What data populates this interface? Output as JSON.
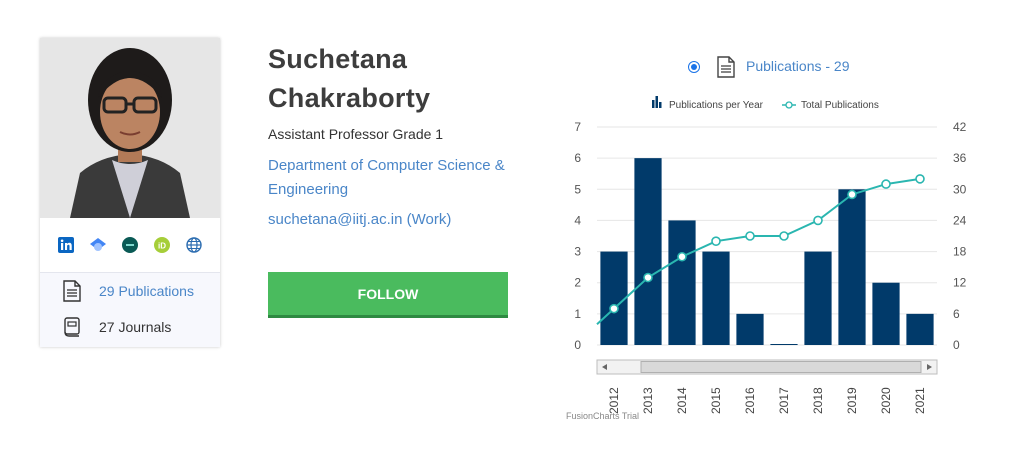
{
  "profile": {
    "name_line1": "Suchetana",
    "name_line2": "Chakraborty",
    "title": "Assistant Professor Grade 1",
    "department": "Department of Computer Science & Engineering",
    "email": "suchetana@iitj.ac.in (Work)",
    "follow_label": "FOLLOW",
    "social_icons": [
      "linkedin-icon",
      "google-scholar-icon",
      "researchgate-icon",
      "orcid-icon",
      "website-globe-icon"
    ],
    "stats": {
      "publications": "29 Publications",
      "journals": "27 Journals"
    }
  },
  "publications_header": {
    "label": "Publications - 29",
    "selected": true
  },
  "colors": {
    "bar": "#013a6a",
    "line": "#2ab6b0",
    "link": "#4a86c8",
    "follow": "#4abb5e"
  },
  "chart_data": {
    "type": "bar",
    "categories": [
      "2012",
      "2013",
      "2014",
      "2015",
      "2016",
      "2017",
      "2018",
      "2019",
      "2020",
      "2021"
    ],
    "series": [
      {
        "name": "Publications per Year",
        "type": "bar",
        "axis": "left",
        "values": [
          3,
          6,
          4,
          3,
          1,
          0,
          3,
          5,
          2,
          1
        ]
      },
      {
        "name": "Total Publications",
        "type": "line",
        "axis": "right",
        "values": [
          7,
          13,
          17,
          20,
          21,
          21,
          24,
          29,
          31,
          32
        ]
      }
    ],
    "y_left": {
      "min": 0,
      "max": 7,
      "ticks": [
        0,
        1,
        2,
        3,
        4,
        5,
        6,
        7
      ]
    },
    "y_right": {
      "min": 0,
      "max": 42,
      "ticks": [
        0,
        6,
        12,
        18,
        24,
        30,
        36,
        42
      ]
    },
    "legend_position": "top-center",
    "grid": true,
    "watermark": "FusionCharts Trial"
  }
}
